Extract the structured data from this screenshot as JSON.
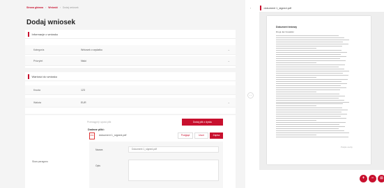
{
  "breadcrumb": {
    "items": [
      "Strona główna",
      "Wnioski",
      "Dodaj wniosek"
    ]
  },
  "page": {
    "title": "Dodaj wniosek"
  },
  "section_info": {
    "title": "Informacje o wniosku",
    "fields": [
      {
        "label": "Kategoria",
        "value": "Wniosek o wydatku"
      },
      {
        "label": "Priorytet",
        "value": "Niski"
      }
    ]
  },
  "section_value": {
    "title": "Wartości do wniosku",
    "fields": [
      {
        "label": "Kwota",
        "value": "123"
      },
      {
        "label": "Waluta",
        "value": "EUR"
      }
    ]
  },
  "attachments": {
    "section_label": "Skan paragonu",
    "file_input_placeholder": "Przeciągnij i upuść plik",
    "add_button": "Dodaj plik z dysku",
    "files_label": "Dodane pliki:",
    "file": {
      "name": "dokument 1_signed.pdf",
      "icon_text": "PDF"
    },
    "buttons": {
      "preview": "Podgląd",
      "delete": "Usuń",
      "save": "Zapisz"
    },
    "description": {
      "name_label": "Nazwa",
      "name_value": "Dokument 1_signed.pdf",
      "desc_label": "Opis"
    }
  },
  "viewer": {
    "title": "dokument 1_signed.pdf",
    "doc_title": "Dokument testowy",
    "doc_greeting": "Drogi Jan Kowalski",
    "doc_signature": "Podpis osoby",
    "text_lines": 50
  },
  "controls": {
    "collapse": "›",
    "split": "‹ ›",
    "zoom_in": "+",
    "zoom_out": "−",
    "fit": "⊡"
  },
  "colors": {
    "accent": "#c8102e",
    "background": "#f4f4f4"
  }
}
